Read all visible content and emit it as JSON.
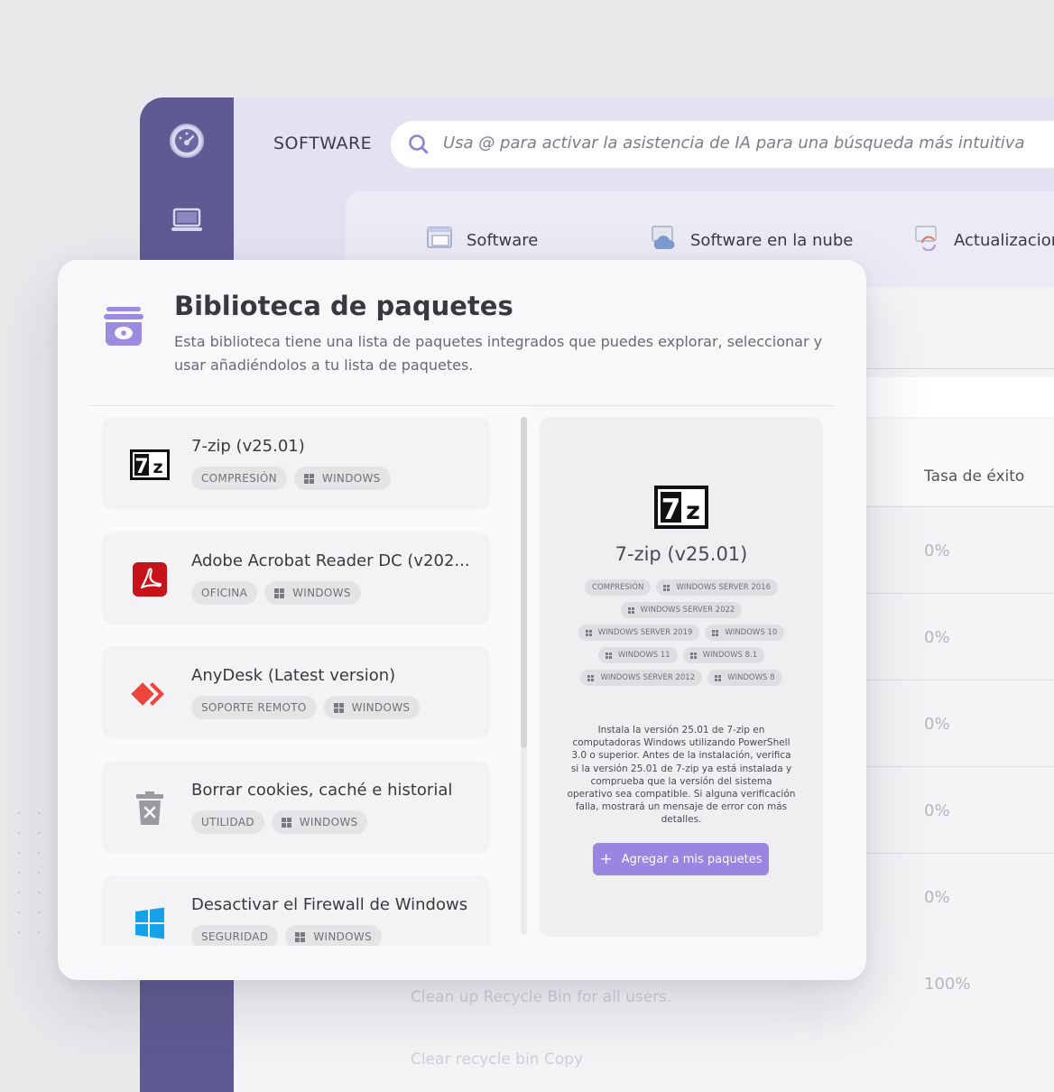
{
  "app": {
    "section_title": "SOFTWARE",
    "search": {
      "placeholder": "Usa @ para activar la asistencia de IA para una búsqueda más intuitiva"
    },
    "tabs": [
      {
        "label": "Software",
        "icon": "window-icon"
      },
      {
        "label": "Software en la nube",
        "icon": "cloud-icon"
      },
      {
        "label": "Actualizaciones del siste",
        "icon": "sync-icon"
      }
    ],
    "table": {
      "column_header": "Tasa de éxito",
      "rates": [
        "0%",
        "0%",
        "0%",
        "0%",
        "0%",
        "100%"
      ],
      "ghost_rows": [
        "Clean up Recycle Bin for all users.",
        "Clear recycle bin Copy"
      ]
    }
  },
  "modal": {
    "title": "Biblioteca de paquetes",
    "description": "Esta biblioteca tiene una lista de paquetes integrados que puedes explorar, seleccionar y usar añadiéndolos a tu lista de paquetes.",
    "packages": [
      {
        "name": "7-zip (v25.01)",
        "category": "COMPRESIÓN",
        "platform": "WINDOWS",
        "logo": "7zip-logo"
      },
      {
        "name": "Adobe Acrobat Reader DC (v202...",
        "category": "OFICINA",
        "platform": "WINDOWS",
        "logo": "acrobat-logo"
      },
      {
        "name": "AnyDesk (Latest version)",
        "category": "SOPORTE REMOTO",
        "platform": "WINDOWS",
        "logo": "anydesk-logo"
      },
      {
        "name": "Borrar cookies, caché e historial",
        "category": "UTILIDAD",
        "platform": "WINDOWS",
        "logo": "trash-icon"
      },
      {
        "name": "Desactivar el Firewall de Windows",
        "category": "SEGURIDAD",
        "platform": "WINDOWS",
        "logo": "windows-logo"
      }
    ],
    "detail": {
      "name": "7-zip (v25.01)",
      "tags": [
        "COMPRESIÓN",
        "WINDOWS SERVER 2016",
        "WINDOWS SERVER 2022",
        "WINDOWS SERVER 2019",
        "WINDOWS 10",
        "WINDOWS 11",
        "WINDOWS 8.1",
        "WINDOWS SERVER 2012",
        "WINDOWS 8"
      ],
      "description": "Instala la versión 25.01 de 7-zip en computadoras Windows utilizando PowerShell 3.0 o superior. Antes de la instalación, verifica si la versión 25.01 de 7-zip ya está instalada y comprueba que la versión del sistema operativo sea compatible. Si alguna verificación falla, mostrará un mensaje de error con más detalles.",
      "add_button": "Agregar a mis paquetes"
    }
  },
  "colors": {
    "sidebar": "#5f5a92",
    "accent": "#9a86e0",
    "header": "#e4e2f1"
  }
}
